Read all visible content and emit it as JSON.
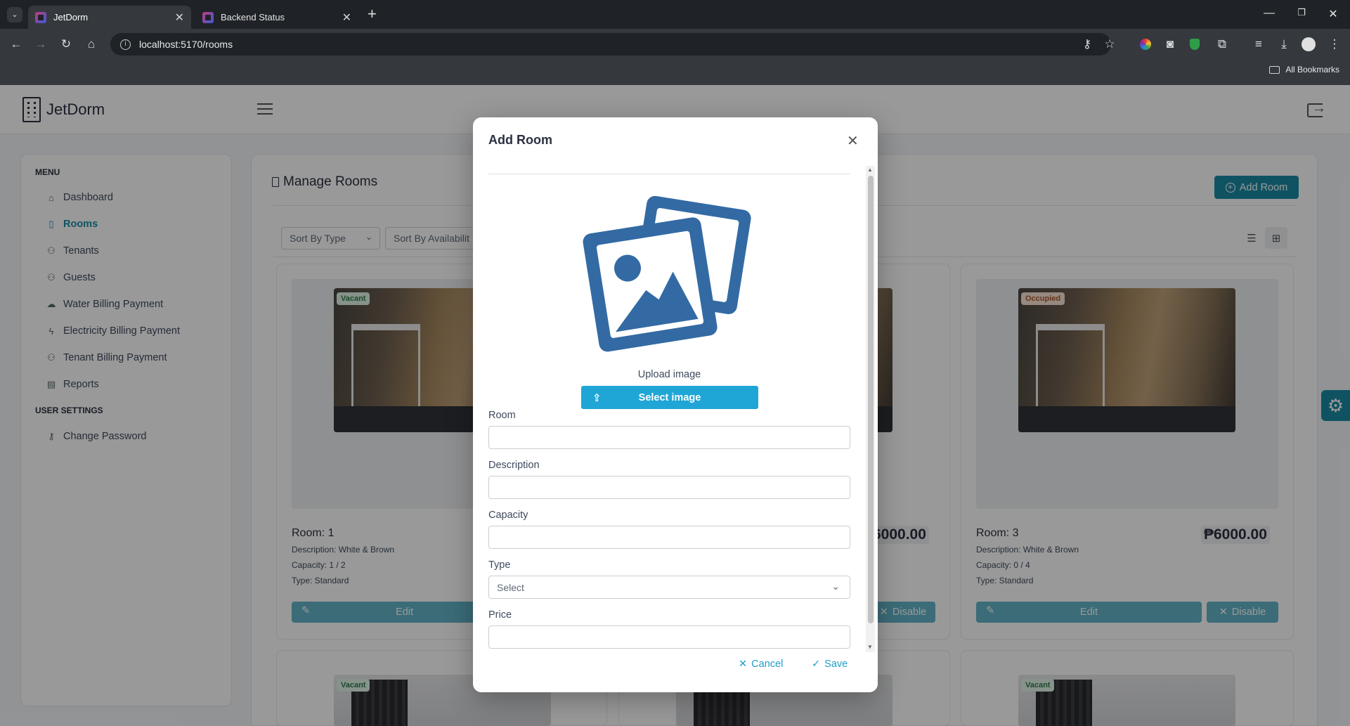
{
  "browser": {
    "tabs": [
      {
        "title": "JetDorm"
      },
      {
        "title": "Backend Status"
      }
    ],
    "url": "localhost:5170/rooms",
    "bookmarks_label": "All Bookmarks"
  },
  "app": {
    "brand": "JetDorm",
    "sidebar": {
      "menu_heading": "MENU",
      "items": [
        {
          "label": "Dashboard",
          "icon": "home-icon"
        },
        {
          "label": "Rooms",
          "icon": "building-icon",
          "active": true
        },
        {
          "label": "Tenants",
          "icon": "users-icon"
        },
        {
          "label": "Guests",
          "icon": "users-icon"
        },
        {
          "label": "Water Billing Payment",
          "icon": "cloud-icon"
        },
        {
          "label": "Electricity Billing Payment",
          "icon": "lightning-icon"
        },
        {
          "label": "Tenant Billing Payment",
          "icon": "users-icon"
        },
        {
          "label": "Reports",
          "icon": "document-icon"
        }
      ],
      "settings_heading": "USER SETTINGS",
      "settings_items": [
        {
          "label": "Change Password",
          "icon": "user-key-icon"
        }
      ]
    },
    "main": {
      "title": "Manage Rooms",
      "add_button": "Add Room",
      "sort_type": "Sort By Type",
      "sort_availability": "Sort By Availabilit",
      "rooms": [
        {
          "status": "Vacant",
          "name": "Room: 1",
          "description": "Description: White & Brown",
          "capacity": "Capacity: 1 / 2",
          "type": "Type: Standard",
          "price": "",
          "edit": "Edit",
          "disable": ""
        },
        {
          "status": "",
          "name": "",
          "description": "",
          "capacity": "",
          "type": "",
          "price": "6000.00",
          "edit": "",
          "disable": "Disable"
        },
        {
          "status": "Occupied",
          "name": "Room: 3",
          "description": "Description: White & Brown",
          "capacity": "Capacity: 0 / 4",
          "type": "Type: Standard",
          "price": "₱6000.00",
          "edit": "Edit",
          "disable": "Disable"
        }
      ],
      "second_row_status": [
        "Vacant",
        "Vacant"
      ]
    }
  },
  "modal": {
    "title": "Add Room",
    "upload_label": "Upload image",
    "select_image": "Select image",
    "fields": {
      "room": "Room",
      "description": "Description",
      "capacity": "Capacity",
      "type": "Type",
      "type_placeholder": "Select",
      "price": "Price"
    },
    "cancel": "Cancel",
    "save": "Save"
  },
  "colors": {
    "accent": "#1a8ba4",
    "select_image_button": "#1fa6d6",
    "browser_dark": "#1f2327"
  }
}
